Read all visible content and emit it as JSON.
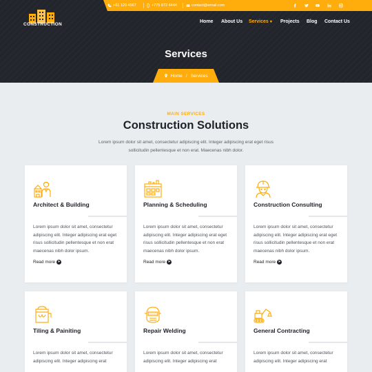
{
  "brand": {
    "logo_text": "CONSTRUCTION"
  },
  "topbar": {
    "phone1": "+61 129 4567",
    "phone2": "+775 872 4444",
    "email": "contact@email.com",
    "social": [
      "facebook-icon",
      "twitter-icon",
      "youtube-icon",
      "linkedin-icon",
      "instagram-icon"
    ]
  },
  "nav": {
    "items": [
      "Home",
      "About Us",
      "Services",
      "Projects",
      "Blog",
      "Contact Us"
    ],
    "active": "Services"
  },
  "banner": {
    "title": "Services",
    "breadcrumb": {
      "home": "Home",
      "sep": "/",
      "current": "Services"
    }
  },
  "section": {
    "kicker": "MAIN SERVICES",
    "heading": "Construction Solutions",
    "intro": "Lorem ipsum dolor sit amet, consectetur adipiscing elit. Integer adipiscing erat eget risus sollicitudin pellentesque et non erat. Maecenas nibh dolor."
  },
  "services": [
    {
      "title": "Architect & Building",
      "icon": "architect-icon",
      "text": "Lorem ipsum dolor sit amet, consectetur adipiscing elit. Integer adipiscing erat eget risus sollicitudin pellentesque et non erat maecenas nibh dolor ipsum.",
      "link": "Read more"
    },
    {
      "title": "Planning & Scheduling",
      "icon": "planning-icon",
      "text": "Lorem ipsum dolor sit amet, consectetur adipiscing elit. Integer adipiscing erat eget risus sollicitudin pellentesque et non erat maecenas nibh dolor ipsum.",
      "link": "Read more"
    },
    {
      "title": "Construction Consulting",
      "icon": "worker-helmet-icon",
      "text": "Lorem ipsum dolor sit amet, consectetur adipiscing elit. Integer adipiscing erat eget risus sollicitudin pellentesque et non erat maecenas nibh dolor ipsum.",
      "link": "Read more"
    },
    {
      "title": "Tiling & Painiting",
      "icon": "paint-bucket-icon",
      "text": "Lorem ipsum dolor sit amet, consectetur adipiscing elit. Integer adipiscing erat"
    },
    {
      "title": "Repair Welding",
      "icon": "welding-mask-icon",
      "text": "Lorem ipsum dolor sit amet, consectetur adipiscing elit. Integer adipiscing erat"
    },
    {
      "title": "General Contracting",
      "icon": "excavator-icon",
      "text": "Lorem ipsum dolor sit amet, consectetur adipiscing elit. Integer adipiscing erat"
    }
  ],
  "colors": {
    "accent": "#ffad0d",
    "dark": "#22262c",
    "bg": "#eaedf0"
  }
}
